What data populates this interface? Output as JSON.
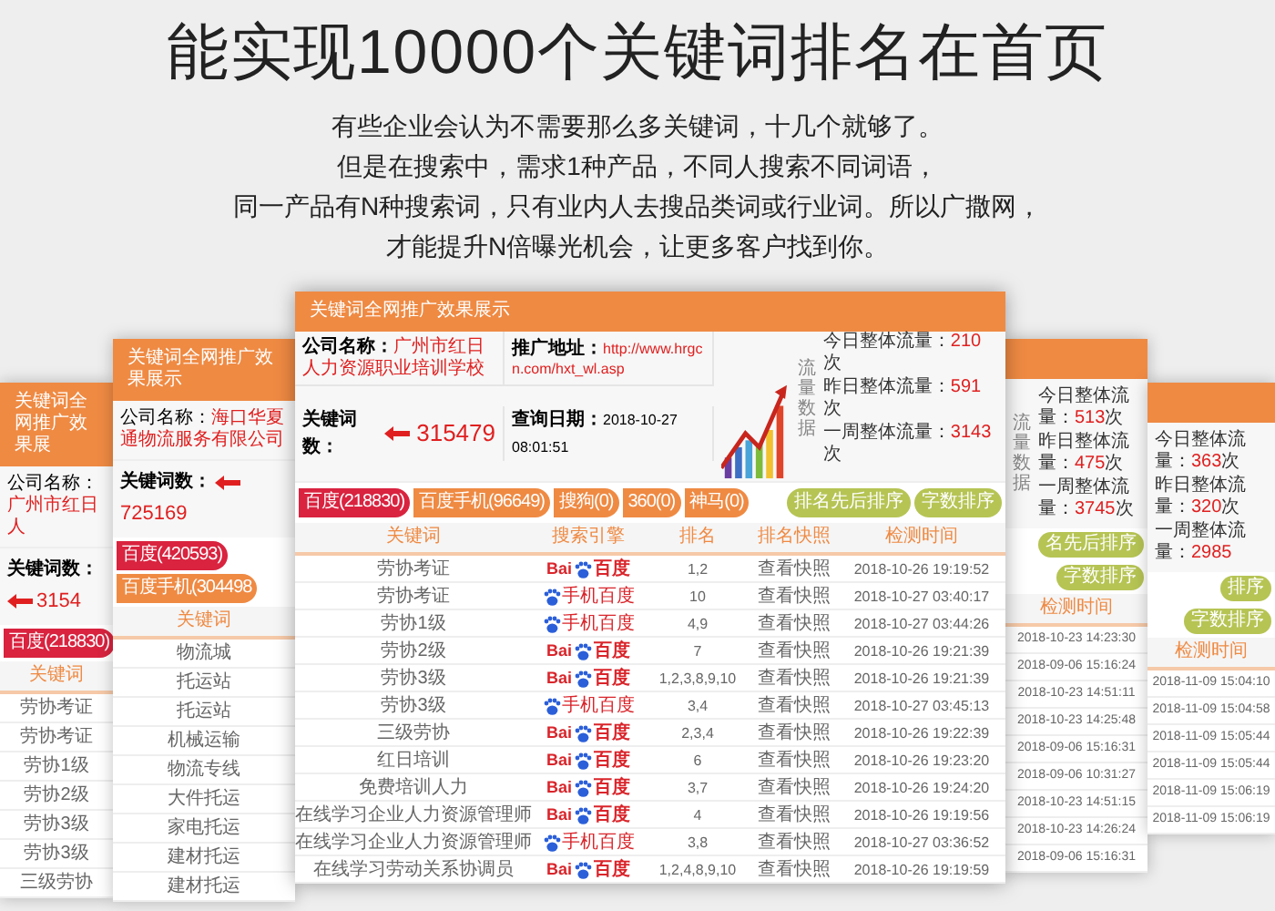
{
  "headline": "能实现10000个关键词排名在首页",
  "intro": [
    "有些企业会认为不需要那么多关键词，十几个就够了。",
    "但是在搜索中，需求1种产品，不同人搜索不同词语，",
    "同一产品有N种搜索词，只有业内人去搜品类词或行业词。所以广撒网，",
    "才能提升N倍曝光机会，让更多客户找到你。"
  ],
  "cards": [
    {
      "kind": "left",
      "title": "关键词全网推广效果展",
      "company": {
        "label": "公司名称：",
        "value": "广州市红日人"
      },
      "keywords": {
        "label": "关键词数：",
        "value": "3154"
      },
      "tabs": [
        {
          "label": "百度(218830)",
          "selected": true
        }
      ],
      "columns": [
        "关键词"
      ],
      "rows": [
        "劳协考证",
        "劳协考证",
        "劳协1级",
        "劳协2级",
        "劳协3级",
        "劳协3级",
        "三级劳协"
      ]
    },
    {
      "kind": "left",
      "title": "关键词全网推广效果展示",
      "company": {
        "label": "公司名称：",
        "value": "海口华夏通物流服务有限公司"
      },
      "keywords": {
        "label": "关键词数：",
        "value": "725169"
      },
      "tabs": [
        {
          "label": "百度(420593)",
          "selected": true
        },
        {
          "label": "百度手机(304498",
          "selected": false
        }
      ],
      "columns": [
        "关键词"
      ],
      "rows": [
        "物流城",
        "托运站",
        "托运站",
        "机械运输",
        "物流专线",
        "大件托运",
        "家电托运",
        "建材托运",
        "建材托运"
      ]
    },
    {
      "kind": "main",
      "title": "关键词全网推广效果展示",
      "company": {
        "label": "公司名称：",
        "value": "广州市红日人力资源职业培训学校"
      },
      "keywords": {
        "label": "关键词数：",
        "value": "315479"
      },
      "url": {
        "label": "推广地址：",
        "value": "http://www.hrgcn.com/hxt_wl.asp"
      },
      "date": {
        "label": "查询日期：",
        "value": "2018-10-27 08:01:51"
      },
      "side_label": "流量数据",
      "stats": [
        {
          "label": "今日整体流量：",
          "value": "210",
          "unit": "次"
        },
        {
          "label": "昨日整体流量：",
          "value": "591",
          "unit": "次"
        },
        {
          "label": "一周整体流量：",
          "value": "3143",
          "unit": "次"
        }
      ],
      "tabs": [
        {
          "label": "百度(218830)",
          "selected": true
        },
        {
          "label": "百度手机(96649)",
          "selected": false
        },
        {
          "label": "搜狗(0)",
          "selected": false
        },
        {
          "label": "360(0)",
          "selected": false
        },
        {
          "label": "神马(0)",
          "selected": false
        }
      ],
      "sort_buttons": [
        "排名先后排序",
        "字数排序"
      ],
      "columns": [
        "关键词",
        "搜索引擎",
        "排名",
        "排名快照",
        "检测时间"
      ],
      "rows": [
        {
          "keyword": "劳协考证",
          "engine": {
            "kind": "pc",
            "prefix": "Bai",
            "label": "百度"
          },
          "rank": "1,2",
          "snapshot": "查看快照",
          "time": "2018-10-26 19:19:52"
        },
        {
          "keyword": "劳协考证",
          "engine": {
            "kind": "mobile",
            "label": "手机百度"
          },
          "rank": "10",
          "snapshot": "查看快照",
          "time": "2018-10-27 03:40:17"
        },
        {
          "keyword": "劳协1级",
          "engine": {
            "kind": "mobile",
            "label": "手机百度"
          },
          "rank": "4,9",
          "snapshot": "查看快照",
          "time": "2018-10-27 03:44:26"
        },
        {
          "keyword": "劳协2级",
          "engine": {
            "kind": "pc",
            "prefix": "Bai",
            "label": "百度"
          },
          "rank": "7",
          "snapshot": "查看快照",
          "time": "2018-10-26 19:21:39"
        },
        {
          "keyword": "劳协3级",
          "engine": {
            "kind": "pc",
            "prefix": "Bai",
            "label": "百度"
          },
          "rank": "1,2,3,8,9,10",
          "snapshot": "查看快照",
          "time": "2018-10-26 19:21:39"
        },
        {
          "keyword": "劳协3级",
          "engine": {
            "kind": "mobile",
            "label": "手机百度"
          },
          "rank": "3,4",
          "snapshot": "查看快照",
          "time": "2018-10-27 03:45:13"
        },
        {
          "keyword": "三级劳协",
          "engine": {
            "kind": "pc",
            "prefix": "Bai",
            "label": "百度"
          },
          "rank": "2,3,4",
          "snapshot": "查看快照",
          "time": "2018-10-26 19:22:39"
        },
        {
          "keyword": "红日培训",
          "engine": {
            "kind": "pc",
            "prefix": "Bai",
            "label": "百度"
          },
          "rank": "6",
          "snapshot": "查看快照",
          "time": "2018-10-26 19:23:20"
        },
        {
          "keyword": "免费培训人力",
          "engine": {
            "kind": "pc",
            "prefix": "Bai",
            "label": "百度"
          },
          "rank": "3,7",
          "snapshot": "查看快照",
          "time": "2018-10-26 19:24:20"
        },
        {
          "keyword": "在线学习企业人力资源管理师",
          "engine": {
            "kind": "pc",
            "prefix": "Bai",
            "label": "百度"
          },
          "rank": "4",
          "snapshot": "查看快照",
          "time": "2018-10-26 19:19:56"
        },
        {
          "keyword": "在线学习企业人力资源管理师",
          "engine": {
            "kind": "mobile",
            "label": "手机百度"
          },
          "rank": "3,8",
          "snapshot": "查看快照",
          "time": "2018-10-27 03:36:52"
        },
        {
          "keyword": "在线学习劳动关系协调员",
          "engine": {
            "kind": "pc",
            "prefix": "Bai",
            "label": "百度"
          },
          "rank": "1,2,4,8,9,10",
          "snapshot": "查看快照",
          "time": "2018-10-26 19:19:59"
        }
      ]
    },
    {
      "kind": "right",
      "side_label": "流量数据",
      "stats": [
        {
          "label": "今日整体流量：",
          "value": "513",
          "unit": "次"
        },
        {
          "label": "昨日整体流量：",
          "value": "475",
          "unit": "次"
        },
        {
          "label": "一周整体流量：",
          "value": "3745",
          "unit": "次"
        }
      ],
      "sort_buttons": [
        "名先后排序",
        "字数排序"
      ],
      "columns": [
        "检测时间"
      ],
      "rows": [
        "2018-10-23 14:23:30",
        "2018-09-06 15:16:24",
        "2018-10-23 14:51:11",
        "2018-10-23 14:25:48",
        "2018-09-06 15:16:31",
        "2018-09-06 10:31:27",
        "2018-10-23 14:51:15",
        "2018-10-23 14:26:24",
        "2018-09-06 15:16:31"
      ]
    },
    {
      "kind": "right",
      "stats": [
        {
          "label": "今日整体流量：",
          "value": "363",
          "unit": "次"
        },
        {
          "label": "昨日整体流量：",
          "value": "320",
          "unit": "次"
        },
        {
          "label": "一周整体流量：",
          "value": "2985"
        }
      ],
      "sort_buttons": [
        "排序",
        "字数排序"
      ],
      "columns": [
        "检测时间"
      ],
      "rows": [
        "2018-11-09 15:04:10",
        "2018-11-09 15:04:58",
        "2018-11-09 15:05:44",
        "2018-11-09 15:05:44",
        "2018-11-09 15:06:19",
        "2018-11-09 15:06:19"
      ]
    }
  ]
}
